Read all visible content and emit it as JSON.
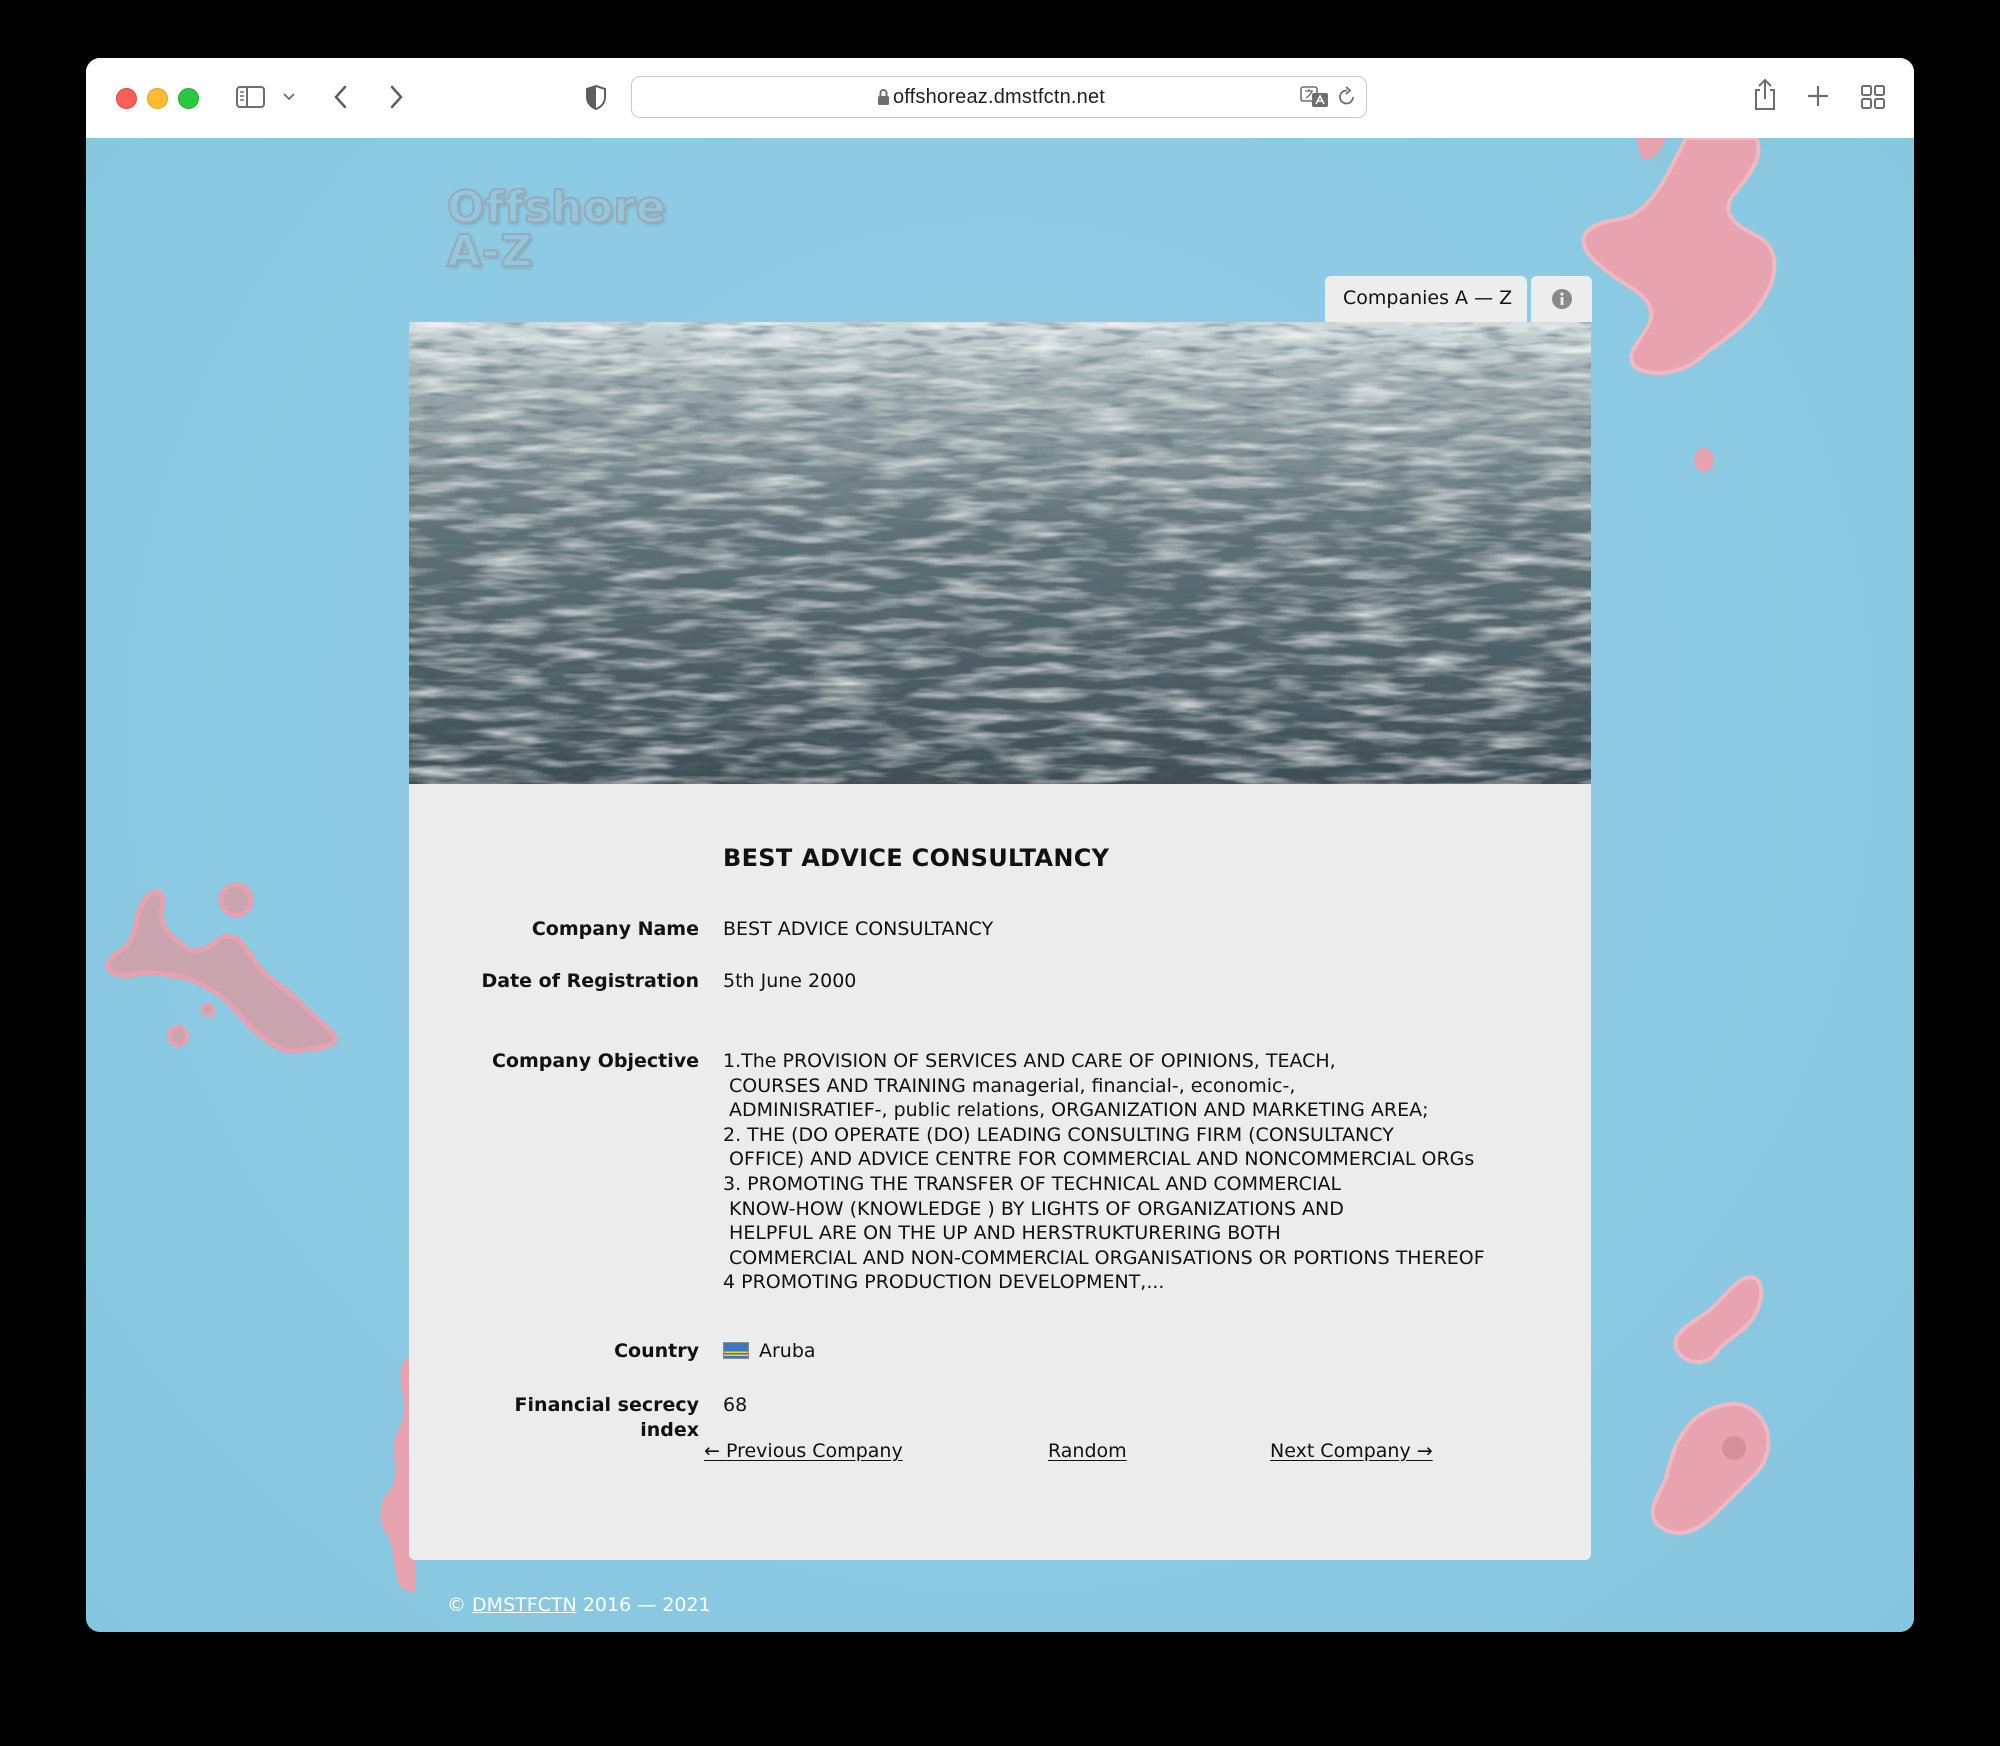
{
  "browser": {
    "url": "offshoreaz.dmstfctn.net"
  },
  "site": {
    "logo_line1": "Offshore",
    "logo_line2": "A-Z",
    "nav_tab": "Companies A — Z"
  },
  "company": {
    "title": "BEST ADVICE CONSULTANCY",
    "fields": {
      "name_label": "Company Name",
      "name_value": "BEST ADVICE CONSULTANCY",
      "date_label": "Date of Registration",
      "date_value": "5th June 2000",
      "objective_label": "Company Objective",
      "objective_value": "1.The PROVISION OF SERVICES AND CARE OF OPINIONS, TEACH,\n COURSES AND TRAINING managerial, financial-, economic-,\n ADMINISRATIEF-, public relations, ORGANIZATION AND MARKETING AREA;\n2. THE (DO OPERATE (DO) LEADING CONSULTING FIRM (CONSULTANCY\n OFFICE) AND ADVICE CENTRE FOR COMMERCIAL AND NONCOMMERCIAL ORGs\n3. PROMOTING THE TRANSFER OF TECHNICAL AND COMMERCIAL\n KNOW-HOW (KNOWLEDGE ) BY LIGHTS OF ORGANIZATIONS AND\n HELPFUL ARE ON THE UP AND HERSTRUKTURERING BOTH\n COMMERCIAL AND NON-COMMERCIAL ORGANISATIONS OR PORTIONS THEREOF\n4 PROMOTING PRODUCTION DEVELOPMENT,...",
      "country_label": "Country",
      "country_value": "Aruba",
      "secrecy_label_line1": "Financial secrecy",
      "secrecy_label_line2": "index",
      "secrecy_value": "68"
    }
  },
  "pager": {
    "previous": "← Previous Company",
    "random": "Random",
    "next": "Next Company →"
  },
  "footer": {
    "copyright": "©",
    "link": "DMSTFCTN",
    "years": "2016 — 2021"
  },
  "colors": {
    "page_bg": "#8ecbe4",
    "card_bg": "#ececec",
    "island": "#e8a3b1"
  }
}
